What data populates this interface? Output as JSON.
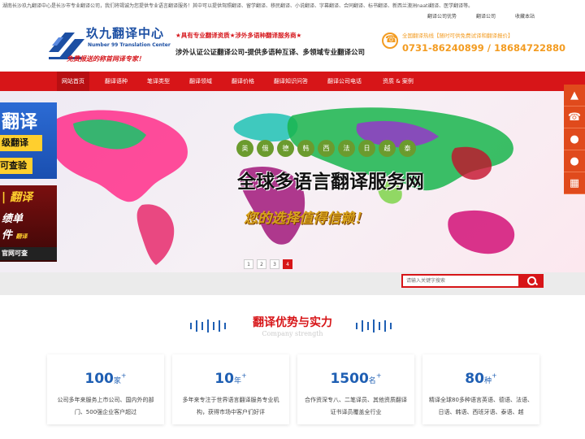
{
  "topbar": {
    "notice": "湖南长沙玖九翻译中心是长沙市专业翻译公司，我们将竭诚为您提供专业语言翻译服务！其中可以提供驾照翻译、留学翻译、移民翻译、小说翻译、字幕翻译、合同翻译、标书翻译、新西兰澳洲naati翻译、医学翻译等。",
    "links": [
      "翻译公司优势",
      "翻译公司",
      "收藏本站"
    ]
  },
  "logo": {
    "name": "玖九翻译中心",
    "en": "Number 99 Translation Center",
    "slogan": "免费报送的称首网译专家！"
  },
  "header": {
    "tagline": "★具有专业翻译资质★涉外多语种翻译服务商★",
    "subtitle": "涉外认证公证翻译公司-提供多语种互译、多领域专业翻译公司"
  },
  "hotline": {
    "label": "全国翻译热线【随时可供免费试译和翻译报价】",
    "phone": "0731-86240899 / 18684722880"
  },
  "nav": {
    "items": [
      "网站首页",
      "翻译语种",
      "笔译类型",
      "翻译领域",
      "翻译价格",
      "翻译知识问答",
      "翻译公司电话",
      "资质 & 案例"
    ]
  },
  "banner": {
    "languages": [
      "英",
      "俄",
      "德",
      "韩",
      "西",
      "法",
      "日",
      "越",
      "泰"
    ],
    "title": "全球多语言翻译服务网",
    "motto": "您的选择值得信赖！",
    "pages": [
      "1",
      "2",
      "3",
      "4"
    ],
    "active_page": "4"
  },
  "left_ad": {
    "big": "翻译",
    "btn1": "级翻译",
    "btn2": "可查验",
    "t1": "| 翻译",
    "t2": "绩单",
    "t3": "件",
    "t3_small": "翻译",
    "t4": "官网可查"
  },
  "right_bar": {
    "icons": [
      "top-icon",
      "phone-icon",
      "qq-icon",
      "qq-icon",
      "qrcode-icon"
    ]
  },
  "search": {
    "placeholder": "请输入关键字搜索"
  },
  "section": {
    "title": "翻译优势与实力",
    "subtitle": "Company strength"
  },
  "stats": [
    {
      "num": "100",
      "unit": "家",
      "sup": "+",
      "desc": "公司多年来服务上市公司、国内外的部门、500强企业客户超过"
    },
    {
      "num": "10",
      "unit": "年",
      "sup": "+",
      "desc": "多年来专注于世界语言翻译服务专业机构，获得市场中客户们好评"
    },
    {
      "num": "1500",
      "unit": "名",
      "sup": "+",
      "desc": "合作资深专八、二笔译员、其他资质翻译证书译员覆盖全行业"
    },
    {
      "num": "80",
      "unit": "种",
      "sup": "+",
      "desc": "精译全球80多种语言英语、德语、法语、日语、韩语、西班牙语、泰语、越"
    }
  ],
  "colors": {
    "brand_red": "#d71518",
    "brand_blue": "#1f5fb3",
    "accent_orange": "#f39c22"
  }
}
